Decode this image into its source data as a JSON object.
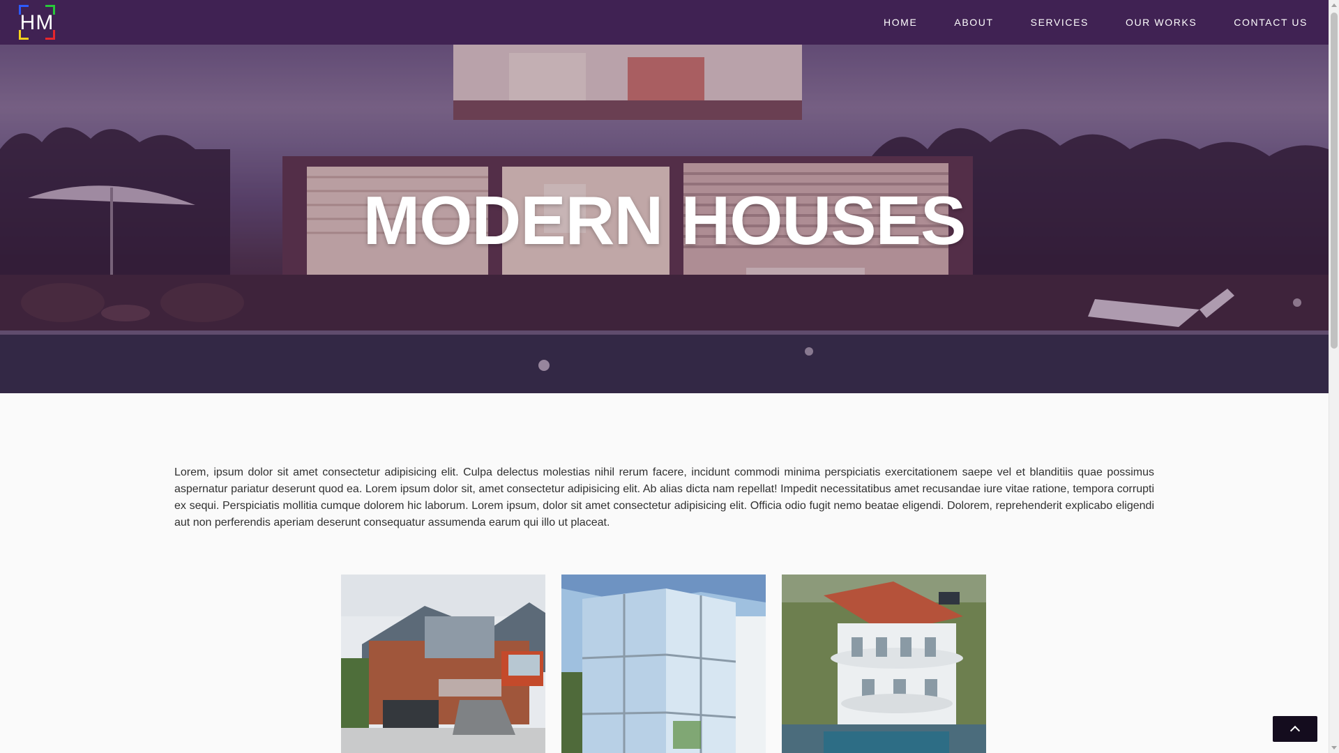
{
  "logo": {
    "text": "HM"
  },
  "nav": {
    "items": [
      {
        "label": "HOME"
      },
      {
        "label": "ABOUT"
      },
      {
        "label": "SERVICES"
      },
      {
        "label": "OUR WORKS"
      },
      {
        "label": "CONTACT US"
      }
    ]
  },
  "hero": {
    "title": "MODERN HOUSES"
  },
  "intro": {
    "text": "Lorem, ipsum dolor sit amet consectetur adipisicing elit. Culpa delectus molestias nihil rerum facere, incidunt commodi minima perspiciatis exercitationem saepe vel et blanditiis quae possimus aspernatur pariatur deserunt quod ea. Lorem ipsum dolor sit, amet consectetur adipisicing elit. Ab alias dicta nam repellat! Impedit necessitatibus amet recusandae iure vitae ratione, tempora corrupti ex sequi. Perspiciatis mollitia cumque dolorem hic laborum. Lorem ipsum, dolor sit amet consectetur adipisicing elit. Officia odio fugit nemo beatae eligendi. Dolorem, reprehenderit explicabo eligendi aut non perferendis aperiam deserunt consequatur assumenda earum qui illo ut placeat."
  },
  "colors": {
    "navbar": "#402253",
    "background": "#fafafa",
    "back_to_top": "#140c1e",
    "logo_corners": [
      "#2d5bff",
      "#28c83a",
      "#f5d21b",
      "#e8262b"
    ]
  },
  "icons": {
    "back_to_top": "chevron-up-icon"
  }
}
